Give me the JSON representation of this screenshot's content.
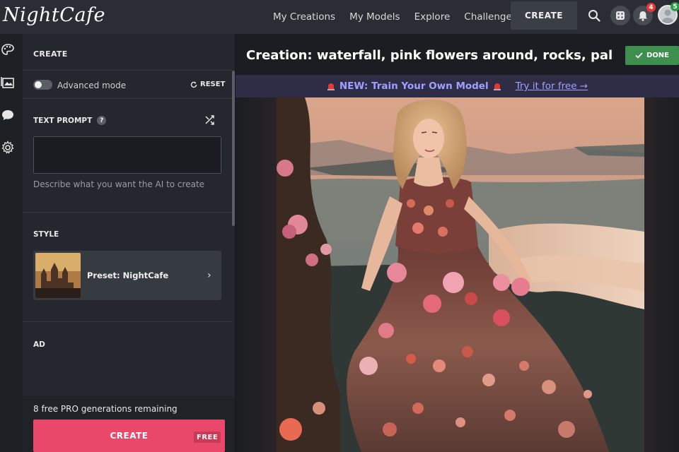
{
  "app": {
    "logo": "NightCafe"
  },
  "nav": {
    "items": [
      "My Creations",
      "My Models",
      "Explore",
      "Challenges"
    ],
    "create_label": "CREATE",
    "notification_count": "4",
    "avatar_badge": "5"
  },
  "panel": {
    "header": "CREATE",
    "advanced_mode_label": "Advanced mode",
    "reset_label": "RESET",
    "text_prompt_label": "TEXT PROMPT",
    "help_glyph": "?",
    "prompt_value": "",
    "prompt_help": "Describe what you want the AI to create",
    "style_label": "STYLE",
    "style_name": "Preset: NightCafe",
    "ad_label": "AD",
    "remaining": "8 free PRO generations remaining",
    "create_button": "CREATE",
    "free_tag": "FREE"
  },
  "main": {
    "title": "Creation: waterfall, pink flowers around, rocks, pal...",
    "done_label": "DONE",
    "banner_text": "NEW: Train Your Own Model",
    "banner_link": "Try it for free →"
  },
  "colors": {
    "accent": "#e9486a",
    "done": "#3e8e4d",
    "banner_text": "#9fa0ff"
  },
  "icons": {
    "rail": [
      "palette-icon",
      "gallery-icon",
      "chat-icon",
      "gear-icon"
    ],
    "topbar": [
      "search-icon",
      "dice-icon",
      "bell-icon"
    ]
  }
}
